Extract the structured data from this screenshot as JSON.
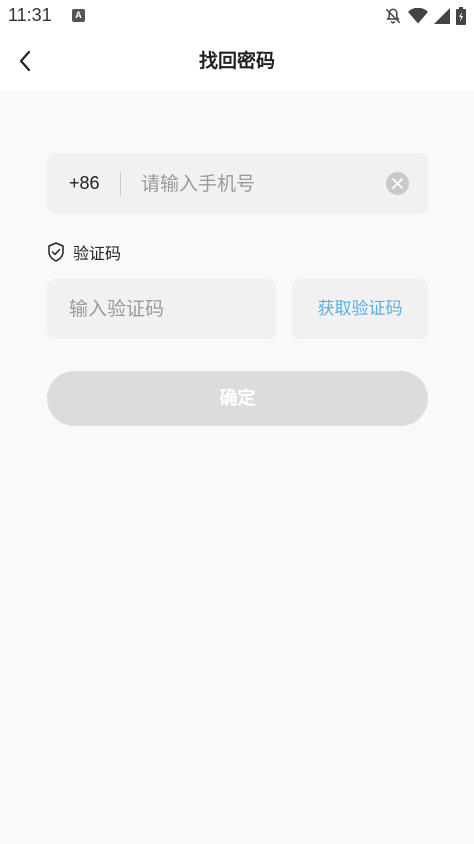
{
  "status_bar": {
    "time": "11:31",
    "app_icon_letter": "A",
    "icons": [
      "notifications-off-icon",
      "wifi-icon",
      "cellular-signal-icon",
      "battery-icon"
    ]
  },
  "header": {
    "title": "找回密码",
    "back_icon": "chevron-left-icon"
  },
  "phone": {
    "country_code": "+86",
    "placeholder": "请输入手机号",
    "value": "",
    "clear_icon": "clear-circle-icon"
  },
  "verification": {
    "label": "验证码",
    "label_icon": "shield-check-icon",
    "placeholder": "输入验证码",
    "value": "",
    "get_code_label": "获取验证码"
  },
  "confirm": {
    "label": "确定"
  },
  "colors": {
    "accent": "#5aaee6",
    "disabled_button": "#dcdcdc",
    "field_bg": "#f1f1f1",
    "page_bg": "#f9f9f9"
  }
}
